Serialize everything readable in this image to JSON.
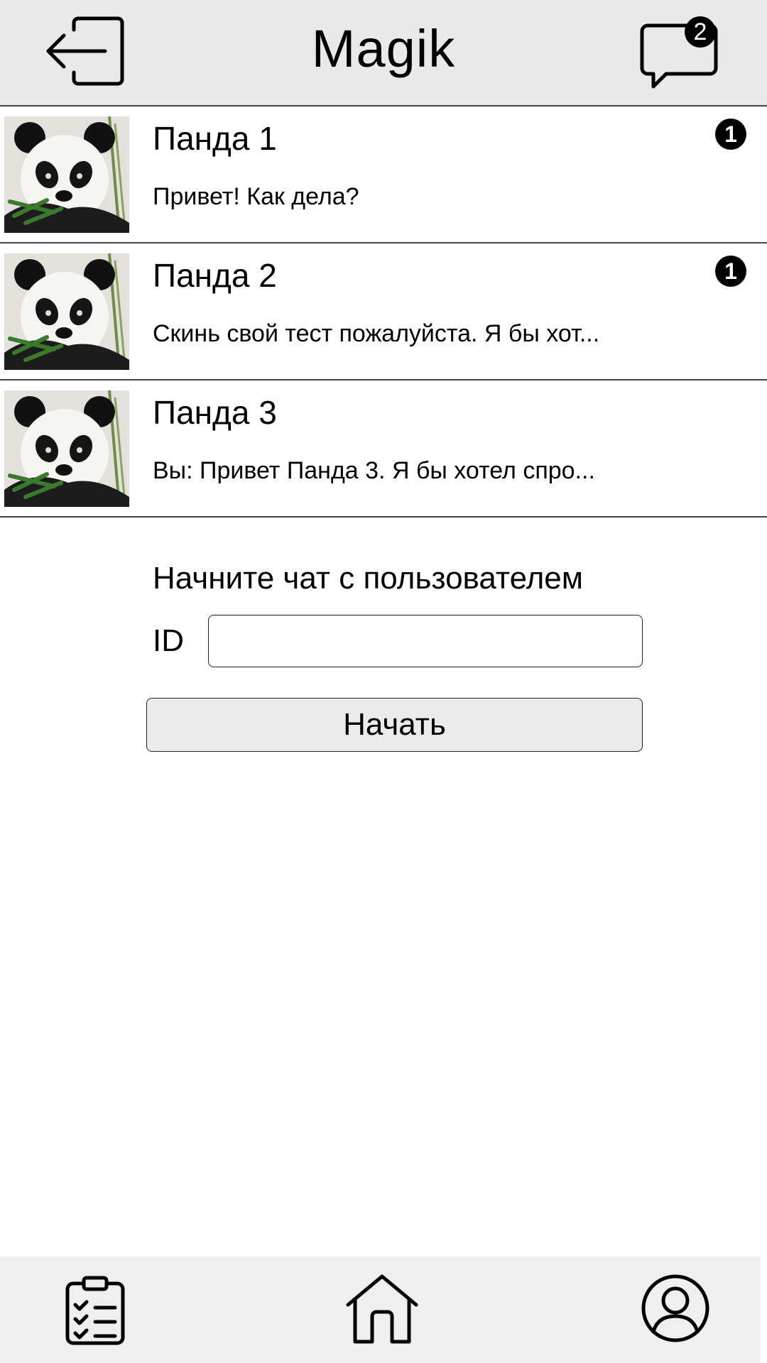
{
  "header": {
    "title": "Magik",
    "back_icon": "logout-arrow-icon",
    "messages_icon": "chat-bubble-icon",
    "messages_badge": "2"
  },
  "chats": [
    {
      "name": "Панда 1",
      "preview": "Привет! Как дела?",
      "unread": "1",
      "avatar": "panda-photo"
    },
    {
      "name": "Панда 2",
      "preview": "Скинь свой тест пожалуйста. Я бы хот...",
      "unread": "1",
      "avatar": "panda-photo"
    },
    {
      "name": "Панда 3",
      "preview": "Вы: Привет Панда 3. Я бы хотел спро...",
      "avatar": "panda-photo"
    }
  ],
  "start_chat": {
    "title": "Начните чат с пользователем",
    "id_label": "ID",
    "id_value": "",
    "button_label": "Начать"
  },
  "bottom_nav": {
    "items": [
      {
        "icon": "clipboard-checklist-icon"
      },
      {
        "icon": "home-icon"
      },
      {
        "icon": "user-profile-icon"
      }
    ]
  },
  "colors": {
    "header_bg": "#e9e9e9",
    "nav_bg": "#efefef",
    "badge": "#000000",
    "button_bg": "#ebebeb"
  }
}
